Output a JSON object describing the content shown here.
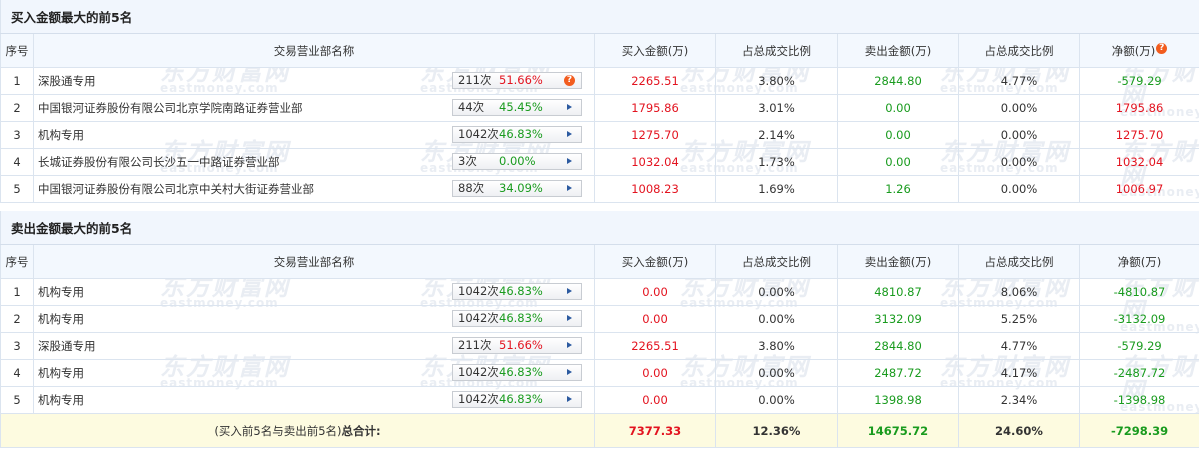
{
  "watermark": {
    "cn": "东方财富网",
    "en": "eastmoney.com"
  },
  "buy_section": {
    "title": "买入金额最大的前5名",
    "headers": [
      "序号",
      "交易营业部名称",
      "买入金额(万)",
      "占总成交比例",
      "卖出金额(万)",
      "占总成交比例",
      "净额(万)"
    ],
    "rows": [
      {
        "idx": "1",
        "name": "深股通专用",
        "count": "211次",
        "rate": "51.66%",
        "rate_color": "red",
        "has_question": true,
        "buy": "2265.51",
        "buy_pct": "3.80%",
        "sell": "2844.80",
        "sell_pct": "4.77%",
        "net": "-579.29",
        "net_color": "green"
      },
      {
        "idx": "2",
        "name": "中国银河证券股份有限公司北京学院南路证券营业部",
        "count": "44次",
        "rate": "45.45%",
        "rate_color": "green",
        "has_question": false,
        "buy": "1795.86",
        "buy_pct": "3.01%",
        "sell": "0.00",
        "sell_pct": "0.00%",
        "net": "1795.86",
        "net_color": "red"
      },
      {
        "idx": "3",
        "name": "机构专用",
        "count": "1042次",
        "rate": "46.83%",
        "rate_color": "green",
        "has_question": false,
        "buy": "1275.70",
        "buy_pct": "2.14%",
        "sell": "0.00",
        "sell_pct": "0.00%",
        "net": "1275.70",
        "net_color": "red"
      },
      {
        "idx": "4",
        "name": "长城证券股份有限公司长沙五一中路证券营业部",
        "count": "3次",
        "rate": "0.00%",
        "rate_color": "green",
        "has_question": false,
        "buy": "1032.04",
        "buy_pct": "1.73%",
        "sell": "0.00",
        "sell_pct": "0.00%",
        "net": "1032.04",
        "net_color": "red"
      },
      {
        "idx": "5",
        "name": "中国银河证券股份有限公司北京中关村大街证券营业部",
        "count": "88次",
        "rate": "34.09%",
        "rate_color": "green",
        "has_question": false,
        "buy": "1008.23",
        "buy_pct": "1.69%",
        "sell": "1.26",
        "sell_pct": "0.00%",
        "net": "1006.97",
        "net_color": "red"
      }
    ]
  },
  "sell_section": {
    "title": "卖出金额最大的前5名",
    "headers": [
      "序号",
      "交易营业部名称",
      "买入金额(万)",
      "占总成交比例",
      "卖出金额(万)",
      "占总成交比例",
      "净额(万)"
    ],
    "rows": [
      {
        "idx": "1",
        "name": "机构专用",
        "count": "1042次",
        "rate": "46.83%",
        "rate_color": "green",
        "buy": "0.00",
        "buy_pct": "0.00%",
        "sell": "4810.87",
        "sell_pct": "8.06%",
        "net": "-4810.87",
        "net_color": "green"
      },
      {
        "idx": "2",
        "name": "机构专用",
        "count": "1042次",
        "rate": "46.83%",
        "rate_color": "green",
        "buy": "0.00",
        "buy_pct": "0.00%",
        "sell": "3132.09",
        "sell_pct": "5.25%",
        "net": "-3132.09",
        "net_color": "green"
      },
      {
        "idx": "3",
        "name": "深股通专用",
        "count": "211次",
        "rate": "51.66%",
        "rate_color": "red",
        "buy": "2265.51",
        "buy_pct": "3.80%",
        "sell": "2844.80",
        "sell_pct": "4.77%",
        "net": "-579.29",
        "net_color": "green"
      },
      {
        "idx": "4",
        "name": "机构专用",
        "count": "1042次",
        "rate": "46.83%",
        "rate_color": "green",
        "buy": "0.00",
        "buy_pct": "0.00%",
        "sell": "2487.72",
        "sell_pct": "4.17%",
        "net": "-2487.72",
        "net_color": "green"
      },
      {
        "idx": "5",
        "name": "机构专用",
        "count": "1042次",
        "rate": "46.83%",
        "rate_color": "green",
        "buy": "0.00",
        "buy_pct": "0.00%",
        "sell": "1398.98",
        "sell_pct": "2.34%",
        "net": "-1398.98",
        "net_color": "green"
      }
    ]
  },
  "totals": {
    "label_prefix": "(买入前5名与卖出前5名)",
    "label_bold": "总合计:",
    "buy": "7377.33",
    "buy_pct": "12.36%",
    "sell": "14675.72",
    "sell_pct": "24.60%",
    "net": "-7298.39"
  },
  "colors": {
    "red": "#e3131f",
    "green": "#199b1e",
    "header_bg": "#f3f8fe",
    "total_bg": "#fdfbe0"
  },
  "icons": {
    "question": "question-icon",
    "arrow": "arrow-right-icon"
  }
}
